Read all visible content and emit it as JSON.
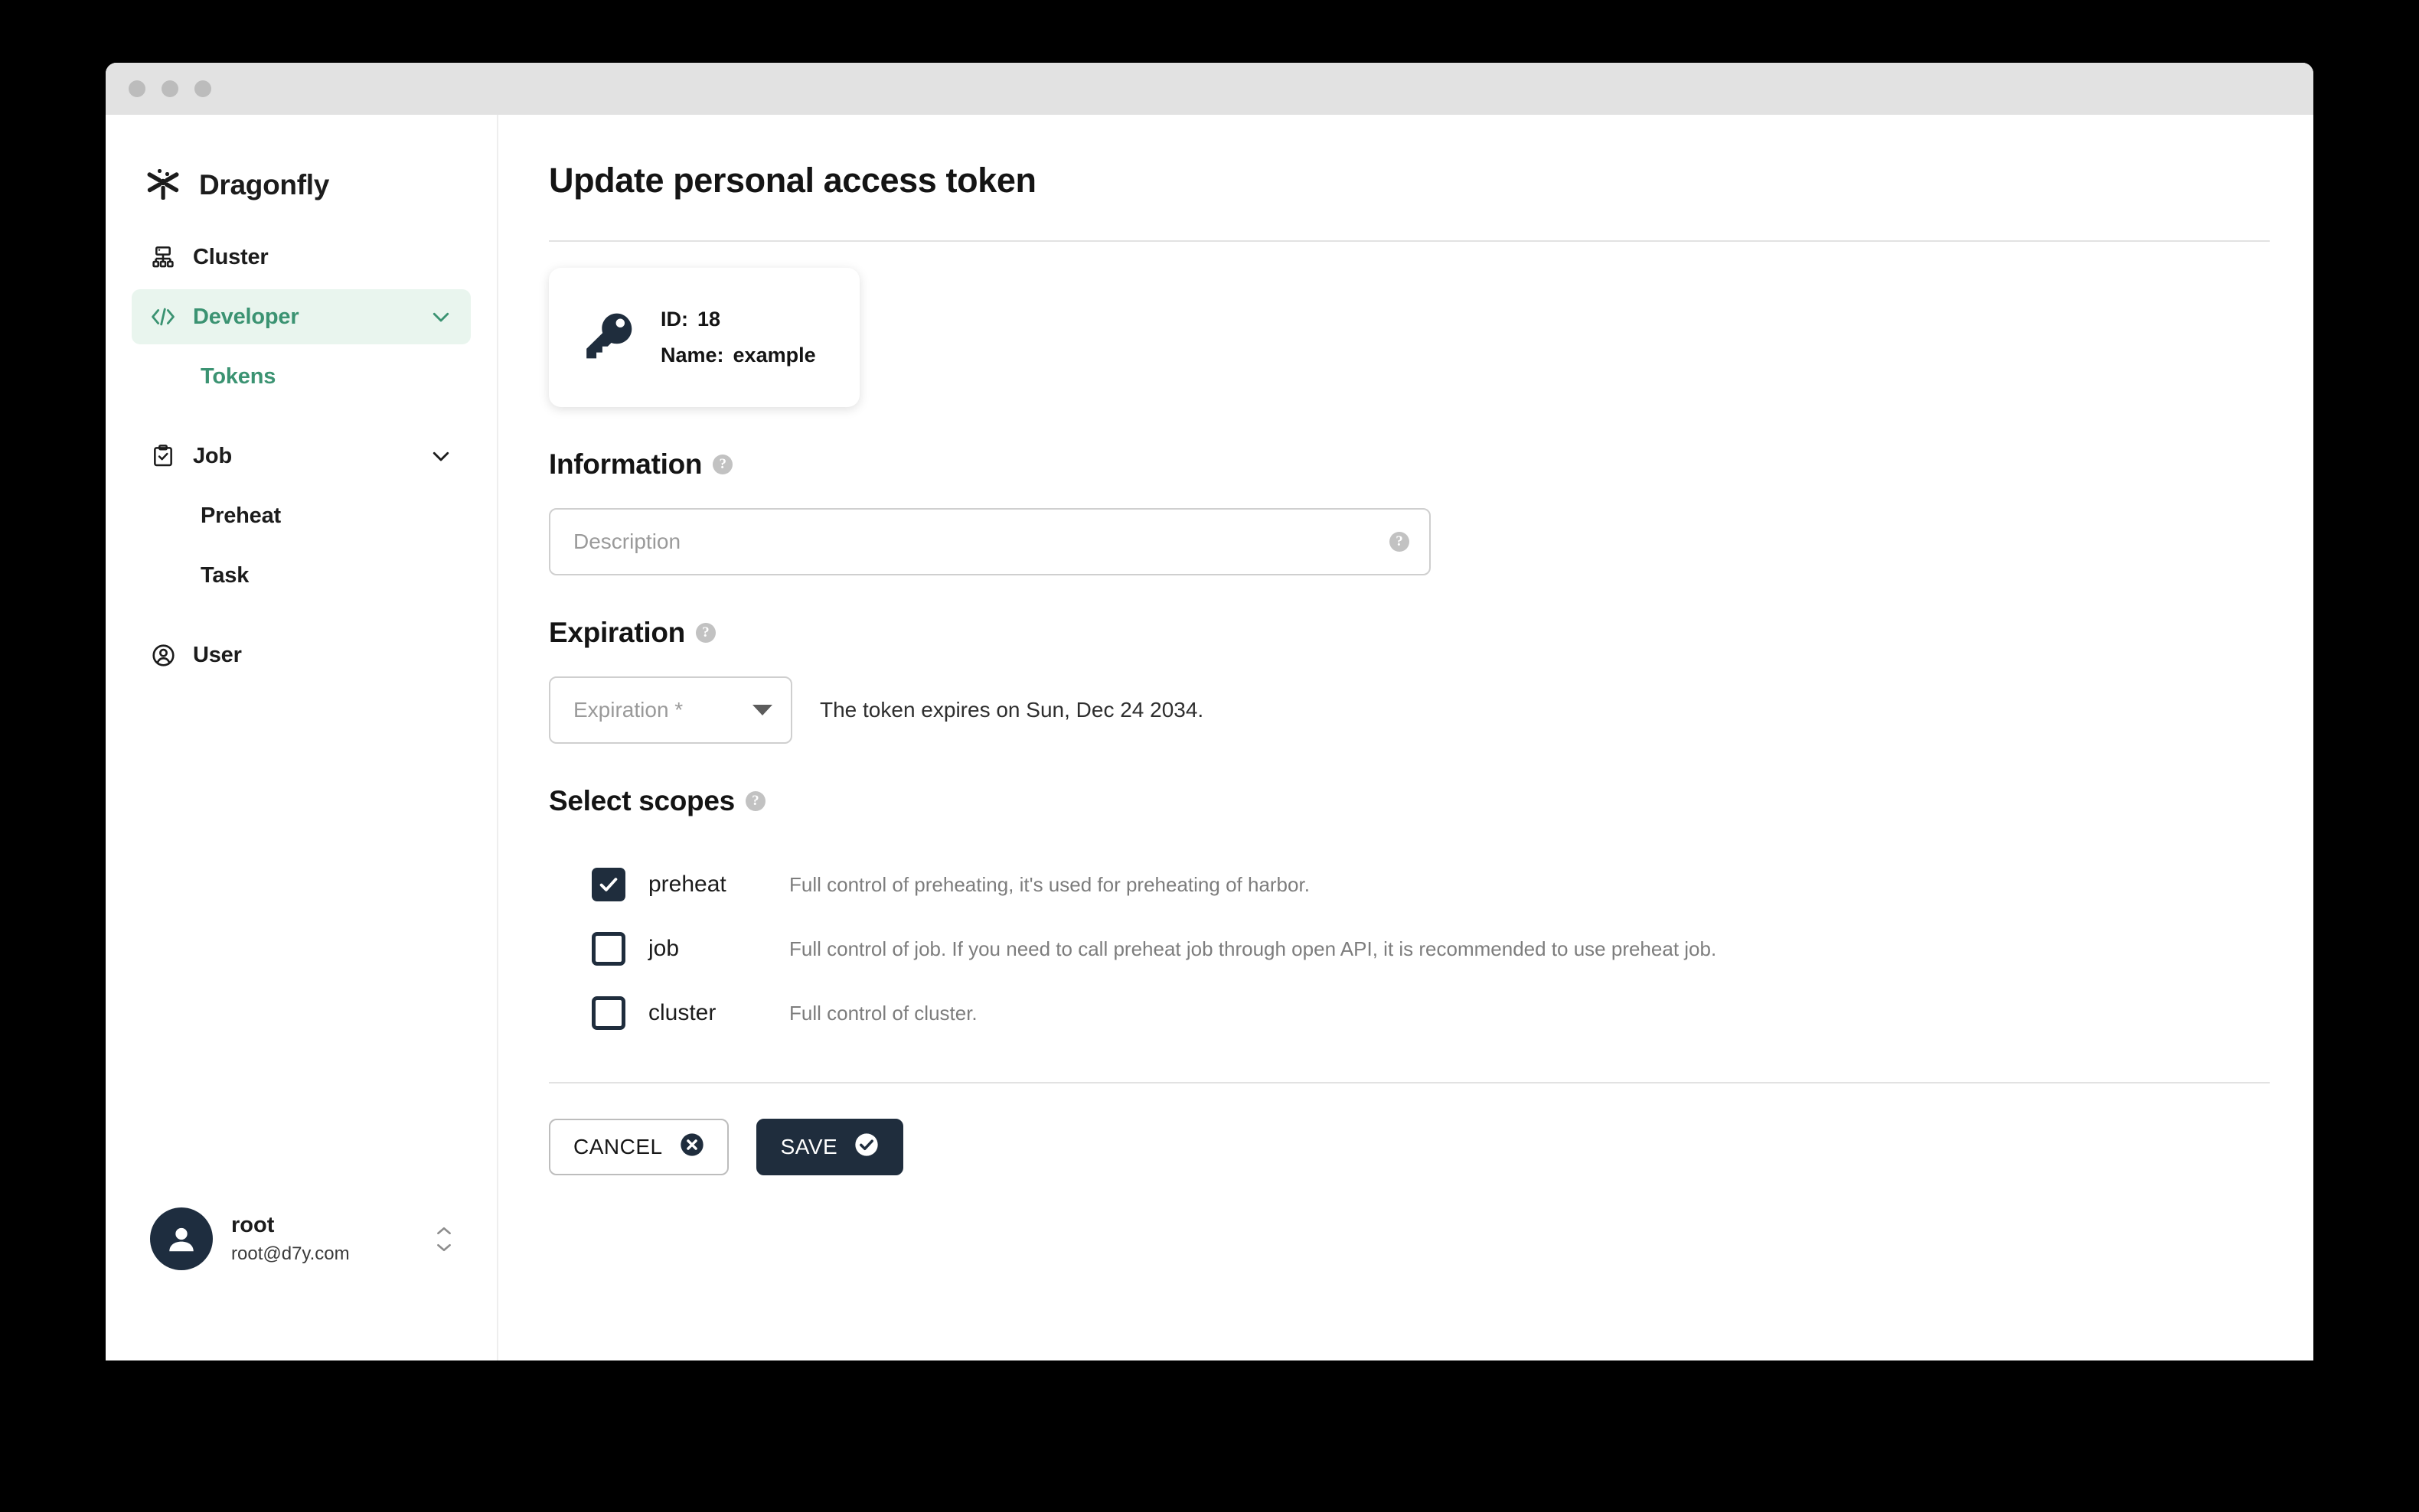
{
  "window": {
    "traffic_lights": [
      "close-dot",
      "minimize-dot",
      "maximize-dot"
    ]
  },
  "sidebar": {
    "brand": {
      "name": "Dragonfly",
      "logo": "dragonfly-logo"
    },
    "items": [
      {
        "label": "Cluster",
        "icon": "cluster-icon",
        "active": false,
        "has_chevron": false
      },
      {
        "label": "Developer",
        "icon": "code-brackets-icon",
        "active": true,
        "has_chevron": true
      },
      {
        "label": "Tokens",
        "icon": "",
        "active": true,
        "sub": true
      },
      {
        "label": "Job",
        "icon": "clipboard-check-icon",
        "active": false,
        "has_chevron": true
      },
      {
        "label": "Preheat",
        "icon": "",
        "active": false,
        "sub": true
      },
      {
        "label": "Task",
        "icon": "",
        "active": false,
        "sub": true
      },
      {
        "label": "User",
        "icon": "user-circle-icon",
        "active": false,
        "has_chevron": false
      }
    ],
    "user": {
      "name": "root",
      "email": "root@d7y.com",
      "avatar": "avatar-icon",
      "switch_icon": "up-down-chevrons-icon"
    }
  },
  "main": {
    "page_title": "Update personal access token",
    "token_card": {
      "icon": "key-icon",
      "id_label": "ID:",
      "id_value": "18",
      "name_label": "Name:",
      "name_value": "example"
    },
    "information": {
      "title": "Information",
      "help_icon": "help-icon",
      "description_placeholder": "Description",
      "description_value": "",
      "field_help_icon": "help-icon"
    },
    "expiration": {
      "title": "Expiration",
      "help_icon": "help-icon",
      "select_placeholder": "Expiration *",
      "select_value": "",
      "caret_icon": "caret-down-icon",
      "note": "The token expires on Sun, Dec 24 2034."
    },
    "scopes": {
      "title": "Select scopes",
      "help_icon": "help-icon",
      "rows": [
        {
          "name": "preheat",
          "checked": true,
          "description": "Full control of preheating, it's used for preheating of harbor."
        },
        {
          "name": "job",
          "checked": false,
          "description": "Full control of job. If you need to call preheat job through open API, it is recommended to use preheat job."
        },
        {
          "name": "cluster",
          "checked": false,
          "description": "Full control of cluster."
        }
      ]
    },
    "actions": {
      "cancel_label": "CANCEL",
      "cancel_icon": "close-circle-icon",
      "save_label": "SAVE",
      "save_icon": "check-circle-icon"
    }
  },
  "colors": {
    "accent_green": "#3b9372",
    "accent_green_bg": "#e9f5ee",
    "dark_navy": "#1f2d3d",
    "border_gray": "#cfcfcf",
    "muted_text": "#7d7d7d"
  }
}
